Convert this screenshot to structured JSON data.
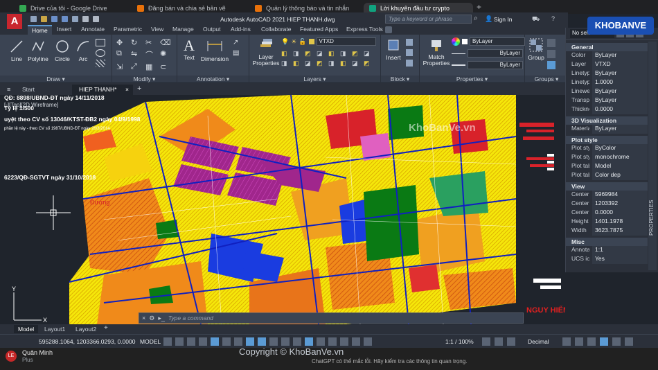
{
  "browser": {
    "tabs": [
      {
        "title": "Drive của tôi - Google Drive",
        "color": "#34a853"
      },
      {
        "title": "Đăng bán và chia sẻ bản vẽ",
        "color": "#e8710a"
      },
      {
        "title": "Quản lý thông báo và tin nhắn",
        "color": "#e8710a"
      },
      {
        "title": "Lời khuyên đầu tư crypto",
        "color": "#10a37f"
      }
    ],
    "new_tab": "+"
  },
  "acad": {
    "title": "Autodesk AutoCAD 2021    HIEP THANH.dwg",
    "search_placeholder": "Type a keyword or phrase",
    "signin": "Sign In",
    "ribbon_tabs": [
      "Home",
      "Insert",
      "Annotate",
      "Parametric",
      "View",
      "Manage",
      "Output",
      "Add-ins",
      "Collaborate",
      "Featured Apps",
      "Express Tools"
    ],
    "draw": {
      "line": "Line",
      "polyline": "Polyline",
      "circle": "Circle",
      "arc": "Arc",
      "label": "Draw ▾"
    },
    "modify_label": "Modify ▾",
    "annotation": {
      "text": "Text",
      "dimension": "Dimension",
      "label": "Annotation ▾"
    },
    "layers": {
      "props": "Layer Properties",
      "current": "VTXD",
      "label": "Layers ▾"
    },
    "block": {
      "insert": "Insert",
      "label": "Block ▾"
    },
    "properties": {
      "match": "Match Properties",
      "color": "ByLayer",
      "linetype": "ByLayer",
      "lineweight": "ByLayer",
      "label": "Properties ▾"
    },
    "groups": {
      "group": "Group",
      "label": "Groups ▾"
    },
    "doc_tabs": [
      "Start",
      "HIEP THANH*"
    ],
    "viewport_label": "[-][Top][2D Wireframe]",
    "command_placeholder": "Type a command",
    "layout_tabs": [
      "Model",
      "Layout1",
      "Layout2"
    ],
    "coords": "595288.1064, 1203366.0293, 0.0000",
    "model_label": "MODEL",
    "scale": "1:1 / 100%",
    "units": "Decimal",
    "accent": "#5b9bd5"
  },
  "drawing_text": {
    "t1": "QĐ: 8898/UBND-ĐT ngày 14/11/2018",
    "t2": "Tỷ lệ 1/500",
    "t3": "uyệt theo CV số 13046/KTST-ĐB2 ngày 04/9/1998",
    "t4": "phần lệ này - theo CV số 1987/UBND-ĐT ngày 26/3/2014",
    "t5": "6223/QĐ-SGTVT ngày 31/10/2018",
    "t6": "Đường",
    "warn": "NGUY HIỂM",
    "watermark": "KhoBanVe.vn"
  },
  "props": {
    "no_selection": "No selection",
    "general_title": "General",
    "general": [
      [
        "Color",
        "ByLayer"
      ],
      [
        "Layer",
        "VTXD"
      ],
      [
        "Linetype",
        "ByLayer"
      ],
      [
        "Linetype scale",
        "1.0000"
      ],
      [
        "Lineweight",
        "ByLayer"
      ],
      [
        "Transparency",
        "ByLayer"
      ],
      [
        "Thickness",
        "0.0000"
      ]
    ],
    "viz_title": "3D Visualization",
    "viz": [
      [
        "Material",
        "ByLayer"
      ]
    ],
    "plot_title": "Plot style",
    "plot": [
      [
        "Plot style",
        "ByColor"
      ],
      [
        "Plot style table",
        "monochrome"
      ],
      [
        "Plot table attached to",
        "Model"
      ],
      [
        "Plot table type",
        "Color dep"
      ]
    ],
    "view_title": "View",
    "view": [
      [
        "Center X",
        "5969984"
      ],
      [
        "Center Y",
        "1203392"
      ],
      [
        "Center Z",
        "0.0000"
      ],
      [
        "Height",
        "1401.1978"
      ],
      [
        "Width",
        "3623.7875"
      ]
    ],
    "misc_title": "Misc",
    "misc": [
      [
        "Annotation scale",
        "1:1"
      ],
      [
        "UCS icon On",
        "Yes"
      ]
    ],
    "side_label": "PROPERTIES"
  },
  "chat": {
    "avatar": "LE",
    "user": "Quân Minh",
    "plan": "Plus",
    "footer": "ChatGPT có thể mắc lỗi. Hãy kiểm tra các thông tin quan trọng.",
    "copyright": "Copyright © KhoBanVe.vn"
  },
  "logo": "KHOBANVE"
}
